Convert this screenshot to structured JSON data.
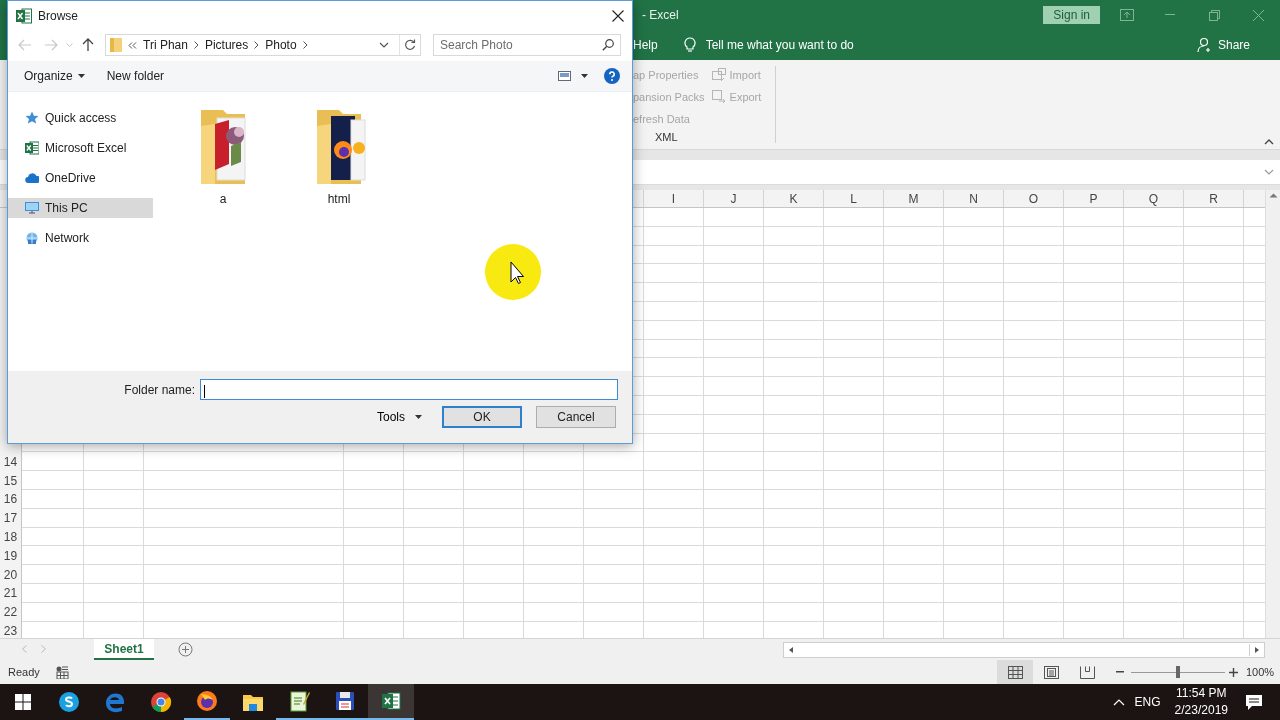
{
  "excel": {
    "title": "- Excel",
    "sign_in": "Sign in",
    "ribbon_tab": "Help",
    "tell_me": "Tell me what you want to do",
    "share": "Share",
    "ribbon_group": {
      "label": "XML",
      "columns": [
        [
          {
            "label": "ap Properties",
            "kind": "text",
            "disabled": true
          },
          {
            "label": "pansion Packs",
            "kind": "text",
            "disabled": true
          },
          {
            "label": "efresh Data",
            "kind": "text",
            "disabled": true
          }
        ],
        [
          {
            "label": "Import",
            "kind": "import",
            "disabled": true
          },
          {
            "label": "Export",
            "kind": "export",
            "disabled": true
          }
        ]
      ]
    },
    "columns": [
      "I",
      "J",
      "K",
      "L",
      "M",
      "N",
      "O",
      "P",
      "Q",
      "R"
    ],
    "rows": [
      "14",
      "15",
      "16",
      "17",
      "18",
      "19",
      "20",
      "21",
      "22",
      "23"
    ],
    "sheet_tabs": [
      {
        "label": "Sheet1",
        "selected": true
      }
    ],
    "status": "Ready",
    "view_buttons": [
      {
        "kind": "normal",
        "selected": true
      },
      {
        "kind": "page-layout",
        "selected": false
      },
      {
        "kind": "page-break",
        "selected": false
      }
    ],
    "zoom": {
      "level": 0.5,
      "reading": "100%"
    }
  },
  "dialog": {
    "title": "Browse",
    "path": [
      "Tri Phan",
      "Pictures",
      "Photo"
    ],
    "search": {
      "placeholder": "Search Photo"
    },
    "toolbar": {
      "organize": "Organize",
      "new_folder": "New folder"
    },
    "nav": [
      {
        "label": "Quick access",
        "kind": "star",
        "selected": false
      },
      {
        "label": "Microsoft Excel",
        "kind": "excel",
        "selected": false
      },
      {
        "label": "OneDrive",
        "kind": "cloud",
        "selected": false
      },
      {
        "label": "This PC",
        "kind": "pc",
        "selected": true
      },
      {
        "label": "Network",
        "kind": "network",
        "selected": false
      }
    ],
    "items": [
      {
        "label": "a",
        "kind": "magazine"
      },
      {
        "label": "html",
        "kind": "browser"
      }
    ],
    "folder_name": {
      "label": "Folder name:"
    },
    "tools": "Tools",
    "ok": "OK",
    "cancel": "Cancel"
  },
  "taskbar": {
    "apps": [
      {
        "kind": "skype",
        "running": false,
        "selected": false
      },
      {
        "kind": "edge",
        "running": false,
        "selected": false
      },
      {
        "kind": "chrome",
        "running": false,
        "selected": false
      },
      {
        "kind": "firefox",
        "running": true,
        "selected": false
      },
      {
        "kind": "explorer",
        "running": false,
        "selected": false
      },
      {
        "kind": "notepad",
        "running": true,
        "selected": false
      },
      {
        "kind": "floppy",
        "running": true,
        "selected": false
      },
      {
        "kind": "excel",
        "running": true,
        "selected": true
      }
    ],
    "language": "ENG",
    "time": "11:54 PM",
    "date": "2/23/2019"
  }
}
